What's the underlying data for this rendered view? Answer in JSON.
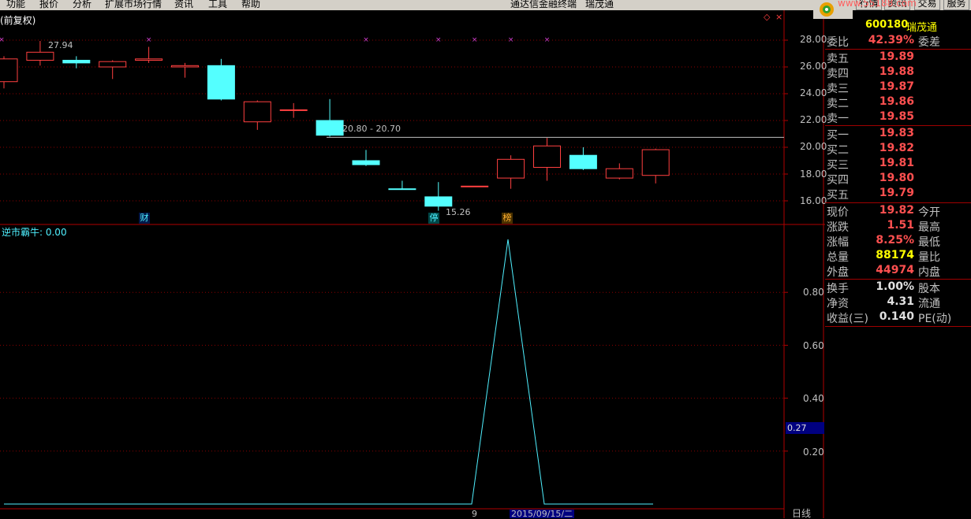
{
  "menu": [
    "功能",
    "报价",
    "分析",
    "扩展市场行情",
    "资讯",
    "工具",
    "帮助"
  ],
  "center_menu": [
    "通达信金融终端",
    "瑞茂通"
  ],
  "top_buttons": [
    "行情",
    "资讯",
    "交易",
    "服务"
  ],
  "watermark": "www.55188.com",
  "window_title": "(前复权)",
  "stock": {
    "code": "600180",
    "name": "瑞茂通"
  },
  "price_axis": [
    "28.00",
    "26.00",
    "24.00",
    "22.00",
    "20.00",
    "18.00",
    "16.00"
  ],
  "annotations": {
    "high": "27.94",
    "low": "15.26",
    "range": "20.80 - 20.70"
  },
  "badges": [
    "财",
    "停",
    "榜"
  ],
  "indicator": {
    "title": "逆市霸牛: 0.00",
    "axis": [
      "0.80",
      "0.60",
      "0.40",
      "0.20"
    ],
    "current": "0.27"
  },
  "footer": {
    "bar_index": "9",
    "date": "2015/09/15/二",
    "period": "日线"
  },
  "quote": {
    "weibi": {
      "label": "委比",
      "value": "42.39%",
      "label2": "委差"
    },
    "sells": [
      {
        "label": "卖五",
        "value": "19.89"
      },
      {
        "label": "卖四",
        "value": "19.88"
      },
      {
        "label": "卖三",
        "value": "19.87"
      },
      {
        "label": "卖二",
        "value": "19.86"
      },
      {
        "label": "卖一",
        "value": "19.85"
      }
    ],
    "buys": [
      {
        "label": "买一",
        "value": "19.83"
      },
      {
        "label": "买二",
        "value": "19.82"
      },
      {
        "label": "买三",
        "value": "19.81"
      },
      {
        "label": "买四",
        "value": "19.80"
      },
      {
        "label": "买五",
        "value": "19.79"
      }
    ],
    "stats": [
      {
        "label": "现价",
        "value": "19.82",
        "label2": "今开",
        "color": "red"
      },
      {
        "label": "涨跌",
        "value": "1.51",
        "label2": "最高",
        "color": "red"
      },
      {
        "label": "涨幅",
        "value": "8.25%",
        "label2": "最低",
        "color": "red"
      },
      {
        "label": "总量",
        "value": "88174",
        "label2": "量比",
        "color": "yel"
      },
      {
        "label": "外盘",
        "value": "44974",
        "label2": "内盘",
        "color": "red"
      }
    ],
    "fund": [
      {
        "label": "换手",
        "value": "1.00%",
        "label2": "股本",
        "color": "wht"
      },
      {
        "label": "净资",
        "value": "4.31",
        "label2": "流通",
        "color": "wht"
      },
      {
        "label": "收益(三)",
        "value": "0.140",
        "label2": "PE(动)",
        "color": "wht"
      }
    ]
  },
  "colors": {
    "up": "#ff4040",
    "down": "#54ffff",
    "grid": "#8b0000",
    "indicator_line": "#4ff0ff"
  },
  "chart_data": {
    "type": "candlestick",
    "ylim": [
      15,
      29
    ],
    "candles": [
      {
        "o": 24.9,
        "h": 26.8,
        "l": 24.4,
        "c": 26.6
      },
      {
        "o": 26.5,
        "h": 27.94,
        "l": 26.1,
        "c": 27.1
      },
      {
        "o": 26.5,
        "h": 26.8,
        "l": 25.9,
        "c": 26.3
      },
      {
        "o": 26.0,
        "h": 26.5,
        "l": 25.1,
        "c": 26.4
      },
      {
        "o": 26.5,
        "h": 27.5,
        "l": 26.3,
        "c": 26.6
      },
      {
        "o": 26.0,
        "h": 26.3,
        "l": 25.2,
        "c": 26.1
      },
      {
        "o": 26.1,
        "h": 26.6,
        "l": 23.5,
        "c": 23.6
      },
      {
        "o": 21.9,
        "h": 23.5,
        "l": 21.3,
        "c": 23.4
      },
      {
        "o": 22.8,
        "h": 23.3,
        "l": 22.2,
        "c": 22.8
      },
      {
        "o": 22.0,
        "h": 23.6,
        "l": 20.8,
        "c": 20.9
      },
      {
        "o": 19.0,
        "h": 19.8,
        "l": 18.6,
        "c": 18.7
      },
      {
        "o": 16.9,
        "h": 17.5,
        "l": 16.9,
        "c": 16.85
      },
      {
        "o": 16.3,
        "h": 17.4,
        "l": 15.26,
        "c": 15.6
      },
      {
        "o": 17.1,
        "h": 17.1,
        "l": 17.1,
        "c": 17.1
      },
      {
        "o": 17.7,
        "h": 19.4,
        "l": 16.9,
        "c": 19.1
      },
      {
        "o": 18.5,
        "h": 20.7,
        "l": 17.5,
        "c": 20.1
      },
      {
        "o": 19.4,
        "h": 20.0,
        "l": 18.3,
        "c": 18.4
      },
      {
        "o": 17.7,
        "h": 18.8,
        "l": 17.6,
        "c": 18.4
      },
      {
        "o": 17.9,
        "h": 19.9,
        "l": 17.3,
        "c": 19.82
      }
    ],
    "indicator": {
      "ylim": [
        0,
        1
      ],
      "values": [
        0,
        0,
        0,
        0,
        0,
        0,
        0,
        0,
        0,
        0,
        0,
        0,
        0,
        0,
        1,
        0,
        0,
        0
      ]
    }
  }
}
